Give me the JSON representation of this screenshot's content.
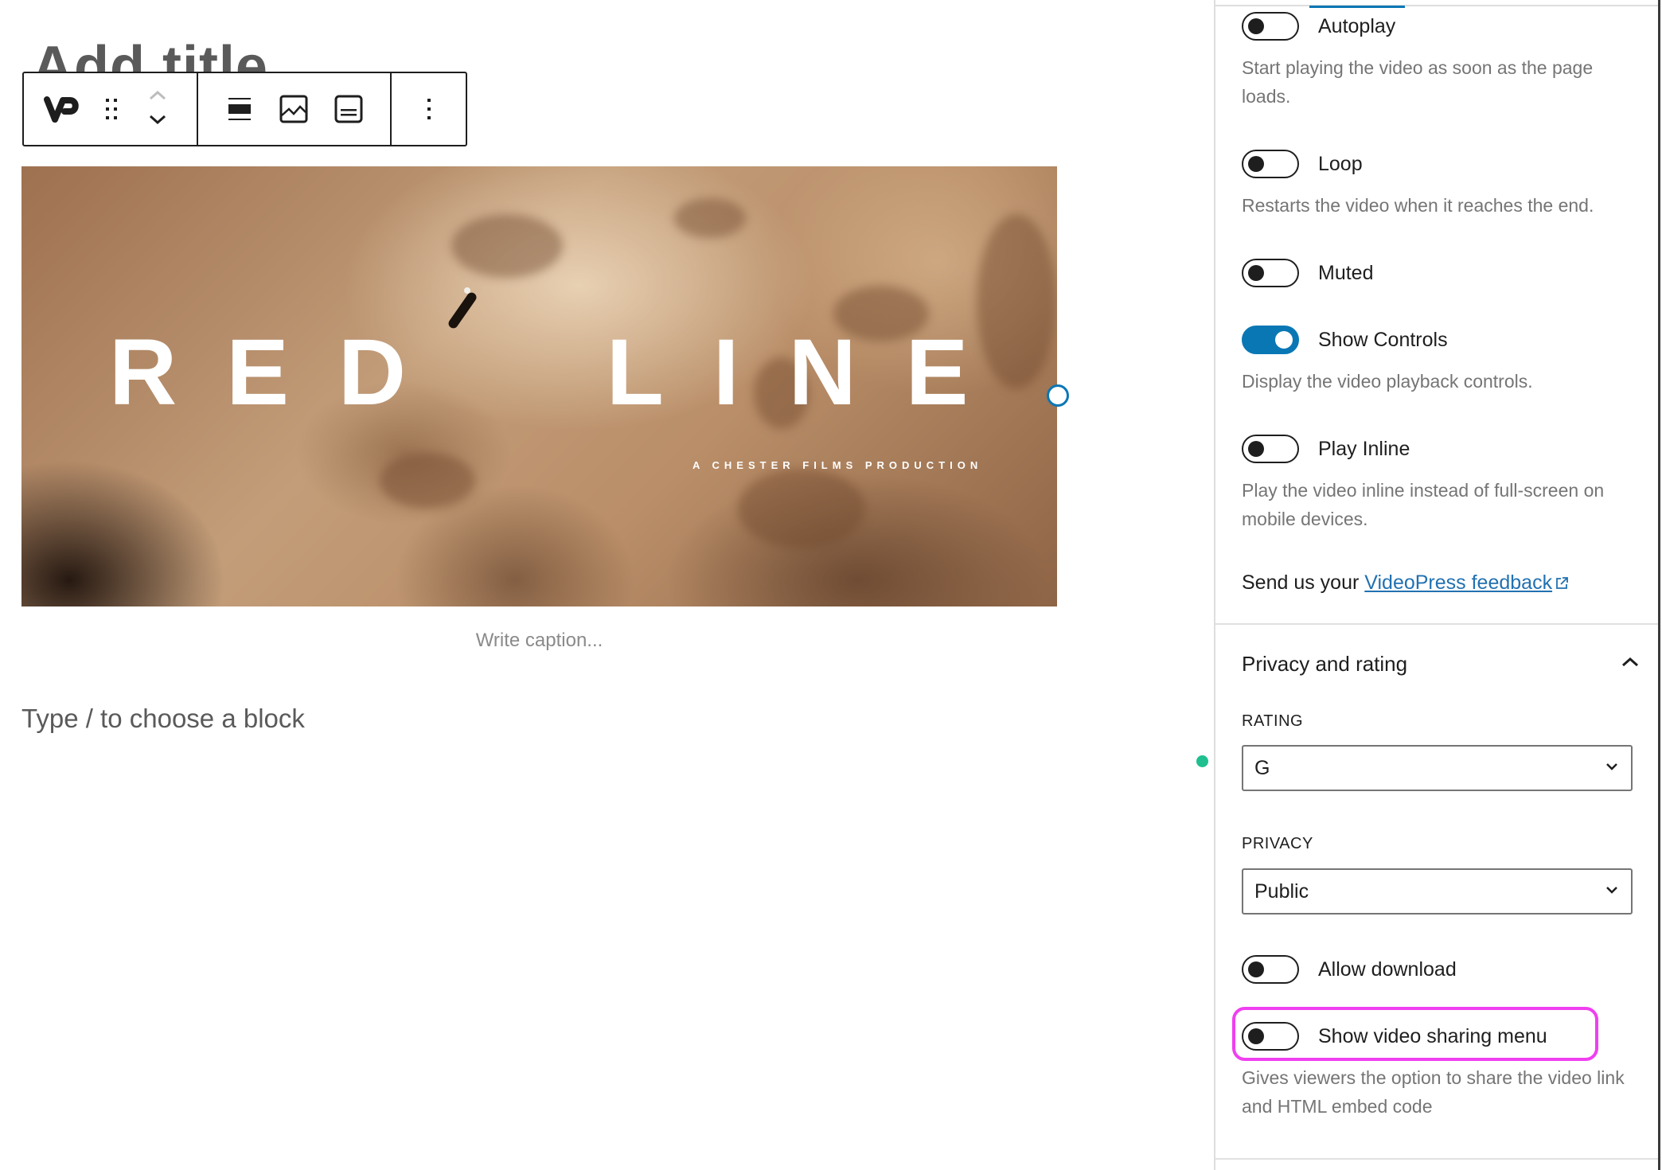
{
  "editor": {
    "post_title_placeholder": "Add title",
    "toolbar": {
      "block_type_icon": "videopress-logo-icon",
      "drag_handle_icon": "drag-handle-icon",
      "move_up_icon": "chevron-up-icon",
      "move_down_icon": "chevron-down-icon",
      "align_icon": "align-wide-icon",
      "poster_icon": "image-icon",
      "tracks_icon": "captions-icon",
      "more_icon": "more-vertical-icon"
    },
    "video": {
      "title_text": "RED  LINE",
      "subtitle_text": "A CHESTER FILMS PRODUCTION"
    },
    "caption_placeholder": "Write caption...",
    "block_placeholder": "Type / to choose a block"
  },
  "sidebar": {
    "settings": [
      {
        "label": "Autoplay",
        "on": false,
        "help": "Start playing the video as soon as the page loads."
      },
      {
        "label": "Loop",
        "on": false,
        "help": "Restarts the video when it reaches the end."
      },
      {
        "label": "Muted",
        "on": false,
        "help": ""
      },
      {
        "label": "Show Controls",
        "on": true,
        "help": "Display the video playback controls."
      },
      {
        "label": "Play Inline",
        "on": false,
        "help": "Play the video inline instead of full-screen on mobile devices."
      }
    ],
    "feedback": {
      "prefix": "Send us your ",
      "link_text": "VideoPress feedback"
    },
    "privacy_panel": {
      "title": "Privacy and rating",
      "expanded": true,
      "rating_label": "RATING",
      "rating_value": "G",
      "privacy_label": "PRIVACY",
      "privacy_value": "Public",
      "toggles": [
        {
          "label": "Allow download",
          "on": false,
          "help": ""
        },
        {
          "label": "Show video sharing menu",
          "on": false,
          "help": "Gives viewers the option to share the video link and HTML embed code",
          "highlighted": true
        }
      ]
    }
  },
  "colors": {
    "accent": "#0a77b5",
    "link": "#2271b1",
    "highlight": "#f03ff0",
    "inserter_dot": "#1fbf8f"
  }
}
